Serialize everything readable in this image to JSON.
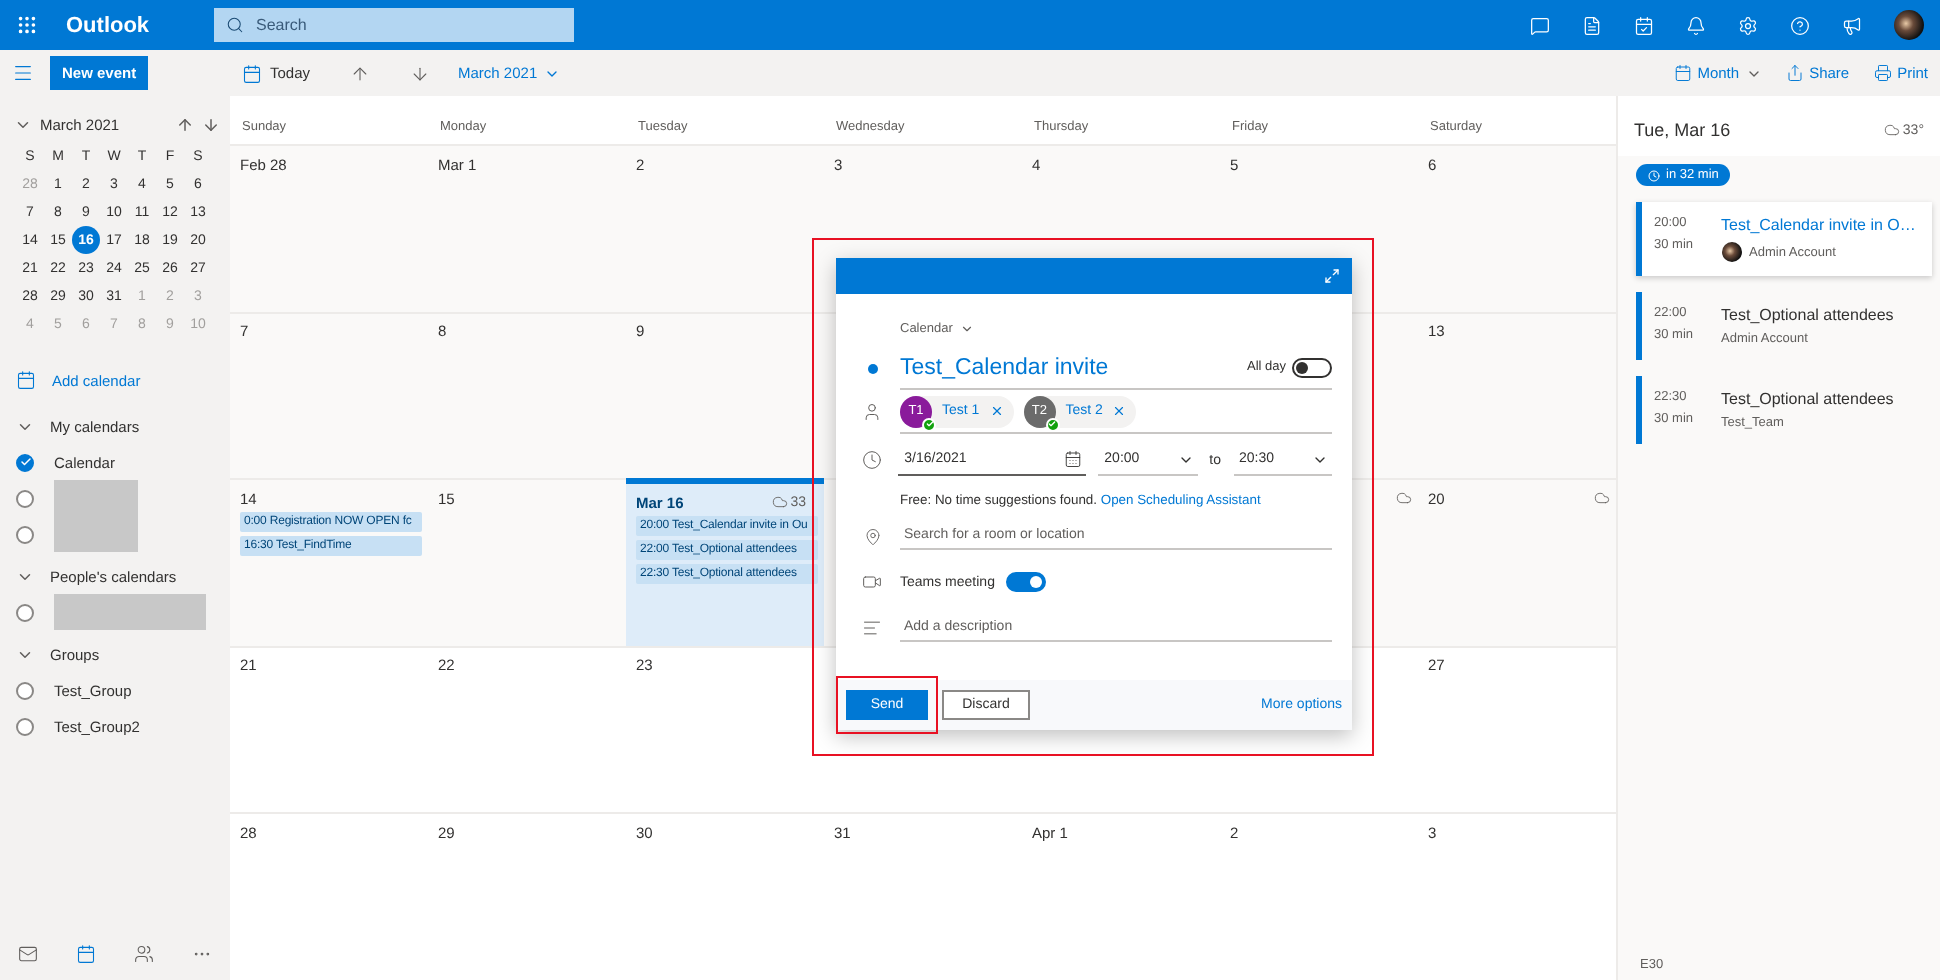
{
  "top_bar": {
    "app_name": "Outlook",
    "search": {
      "placeholder": "Search"
    }
  },
  "toolbar": {
    "today": "Today",
    "period": "March 2021",
    "view": "Month",
    "share": "Share",
    "print": "Print"
  },
  "sidebar": {
    "new_event": "New event",
    "mini_calendar": {
      "title": "March 2021",
      "weekdays": [
        "S",
        "M",
        "T",
        "W",
        "T",
        "F",
        "S"
      ],
      "weeks": [
        [
          {
            "day": "28",
            "muted": true,
            "selected": false
          },
          {
            "day": "1",
            "muted": false,
            "selected": false
          },
          {
            "day": "2",
            "muted": false,
            "selected": false
          },
          {
            "day": "3",
            "muted": false,
            "selected": false
          },
          {
            "day": "4",
            "muted": false,
            "selected": false
          },
          {
            "day": "5",
            "muted": false,
            "selected": false
          },
          {
            "day": "6",
            "muted": false,
            "selected": false
          }
        ],
        [
          {
            "day": "7",
            "muted": false,
            "selected": false
          },
          {
            "day": "8",
            "muted": false,
            "selected": false
          },
          {
            "day": "9",
            "muted": false,
            "selected": false
          },
          {
            "day": "10",
            "muted": false,
            "selected": false
          },
          {
            "day": "11",
            "muted": false,
            "selected": false
          },
          {
            "day": "12",
            "muted": false,
            "selected": false
          },
          {
            "day": "13",
            "muted": false,
            "selected": false
          }
        ],
        [
          {
            "day": "14",
            "muted": false,
            "selected": false
          },
          {
            "day": "15",
            "muted": false,
            "selected": false
          },
          {
            "day": "16",
            "muted": false,
            "selected": true
          },
          {
            "day": "17",
            "muted": false,
            "selected": false
          },
          {
            "day": "18",
            "muted": false,
            "selected": false
          },
          {
            "day": "19",
            "muted": false,
            "selected": false
          },
          {
            "day": "20",
            "muted": false,
            "selected": false
          }
        ],
        [
          {
            "day": "21",
            "muted": false,
            "selected": false
          },
          {
            "day": "22",
            "muted": false,
            "selected": false
          },
          {
            "day": "23",
            "muted": false,
            "selected": false
          },
          {
            "day": "24",
            "muted": false,
            "selected": false
          },
          {
            "day": "25",
            "muted": false,
            "selected": false
          },
          {
            "day": "26",
            "muted": false,
            "selected": false
          },
          {
            "day": "27",
            "muted": false,
            "selected": false
          }
        ],
        [
          {
            "day": "28",
            "muted": false,
            "selected": false
          },
          {
            "day": "29",
            "muted": false,
            "selected": false
          },
          {
            "day": "30",
            "muted": false,
            "selected": false
          },
          {
            "day": "31",
            "muted": false,
            "selected": false
          },
          {
            "day": "1",
            "muted": true,
            "selected": false
          },
          {
            "day": "2",
            "muted": true,
            "selected": false
          },
          {
            "day": "3",
            "muted": true,
            "selected": false
          }
        ],
        [
          {
            "day": "4",
            "muted": true,
            "selected": false
          },
          {
            "day": "5",
            "muted": true,
            "selected": false
          },
          {
            "day": "6",
            "muted": true,
            "selected": false
          },
          {
            "day": "7",
            "muted": true,
            "selected": false
          },
          {
            "day": "8",
            "muted": true,
            "selected": false
          },
          {
            "day": "9",
            "muted": true,
            "selected": false
          },
          {
            "day": "10",
            "muted": true,
            "selected": false
          }
        ]
      ]
    },
    "add_calendar": "Add calendar",
    "sections": [
      {
        "title": "My calendars",
        "items": [
          {
            "kind": "label",
            "label": "Calendar",
            "checked": true
          },
          {
            "kind": "redacted",
            "checked": false
          },
          {
            "kind": "redacted",
            "checked": false
          }
        ]
      },
      {
        "title": "People's calendars",
        "items": [
          {
            "kind": "redacted",
            "checked": false
          }
        ]
      },
      {
        "title": "Groups",
        "items": [
          {
            "kind": "label",
            "label": "Test_Group",
            "checked": false
          },
          {
            "kind": "label",
            "label": "Test_Group2",
            "checked": false
          }
        ]
      }
    ]
  },
  "month": {
    "weekdays": [
      "Sunday",
      "Monday",
      "Tuesday",
      "Wednesday",
      "Thursday",
      "Friday",
      "Saturday"
    ],
    "weeks": [
      {
        "days": [
          {
            "date": "Feb 28",
            "today": false,
            "weather_icon": false
          },
          {
            "date": "Mar 1",
            "today": false,
            "weather_icon": false
          },
          {
            "date": "2",
            "today": false,
            "weather_icon": false
          },
          {
            "date": "3",
            "today": false,
            "weather_icon": false
          },
          {
            "date": "4",
            "today": false,
            "weather_icon": false
          },
          {
            "date": "5",
            "today": false,
            "weather_icon": false
          },
          {
            "date": "6",
            "today": false,
            "weather_icon": false
          }
        ]
      },
      {
        "days": [
          {
            "date": "7",
            "today": false,
            "weather_icon": false
          },
          {
            "date": "8",
            "today": false,
            "weather_icon": false
          },
          {
            "date": "9",
            "today": false,
            "weather_icon": false
          }
        ],
        "after_dialog": [
          {
            "date": "13",
            "today": false,
            "weather_icon": false
          }
        ]
      },
      {
        "days": [
          {
            "date": "14",
            "today": false,
            "weather_icon": false,
            "events": [
              "0:00 Registration NOW OPEN fc",
              "16:30 Test_FindTime"
            ]
          },
          {
            "date": "15",
            "today": false,
            "weather_icon": false
          },
          {
            "date": "Mar 16",
            "today": true,
            "weather_icon": true,
            "weather_reading": "33",
            "events": [
              "20:00 Test_Calendar invite in Ou",
              "22:00 Test_Optional attendees",
              "22:30 Test_Optional attendees"
            ]
          }
        ],
        "after_dialog": [
          {
            "today": false,
            "weather_icon": true
          },
          {
            "date": "20",
            "today": false,
            "weather_icon": true
          }
        ]
      },
      {
        "days": [
          {
            "date": "21",
            "today": false,
            "weather_icon": false
          },
          {
            "date": "22",
            "today": false,
            "weather_icon": false
          },
          {
            "date": "23",
            "today": false,
            "weather_icon": false
          }
        ],
        "after_dialog": [
          {
            "date": "27",
            "today": false,
            "weather_icon": false
          }
        ]
      },
      {
        "days": [
          {
            "date": "28",
            "today": false,
            "weather_icon": false
          },
          {
            "date": "29",
            "today": false,
            "weather_icon": false
          },
          {
            "date": "30",
            "today": false,
            "weather_icon": false
          },
          {
            "date": "31",
            "today": false,
            "weather_icon": false
          },
          {
            "date": "Apr 1",
            "today": false,
            "weather_icon": false
          },
          {
            "date": "2",
            "today": false,
            "weather_icon": false
          },
          {
            "date": "3",
            "today": false,
            "weather_icon": false
          }
        ]
      }
    ]
  },
  "agenda": {
    "date": "Tue, Mar 16",
    "weather": "33°",
    "countdown": "in 32 min",
    "events": [
      {
        "time": "20:00",
        "duration": "30 min",
        "title": "Test_Calendar invite in O…",
        "organizer": "Admin Account",
        "selected": true,
        "avatar": true
      },
      {
        "time": "22:00",
        "duration": "30 min",
        "title": "Test_Optional attendees",
        "organizer": "Admin Account",
        "selected": false,
        "avatar": false
      },
      {
        "time": "22:30",
        "duration": "30 min",
        "title": "Test_Optional attendees",
        "organizer": "Test_Team",
        "selected": false,
        "avatar": false
      }
    ],
    "footer": "E30"
  },
  "compose": {
    "calendar": "Calendar",
    "title": "Test_Calendar invite",
    "all_day": {
      "label": "All day",
      "on": false
    },
    "attendees": [
      {
        "initials": "T1",
        "name": "Test 1",
        "color": "#8a1b9b"
      },
      {
        "initials": "T2",
        "name": "Test 2",
        "color": "#6b6b6b"
      }
    ],
    "date": "3/16/2021",
    "start": "20:00",
    "to": "to",
    "end": "20:30",
    "suggestion": "Free: No time suggestions found.",
    "scheduling_link": "Open Scheduling Assistant",
    "location": {
      "placeholder": "Search for a room or location"
    },
    "teams": {
      "label": "Teams meeting",
      "on": true
    },
    "description": {
      "placeholder": "Add a description"
    },
    "send": "Send",
    "discard": "Discard",
    "more_options": "More options"
  }
}
